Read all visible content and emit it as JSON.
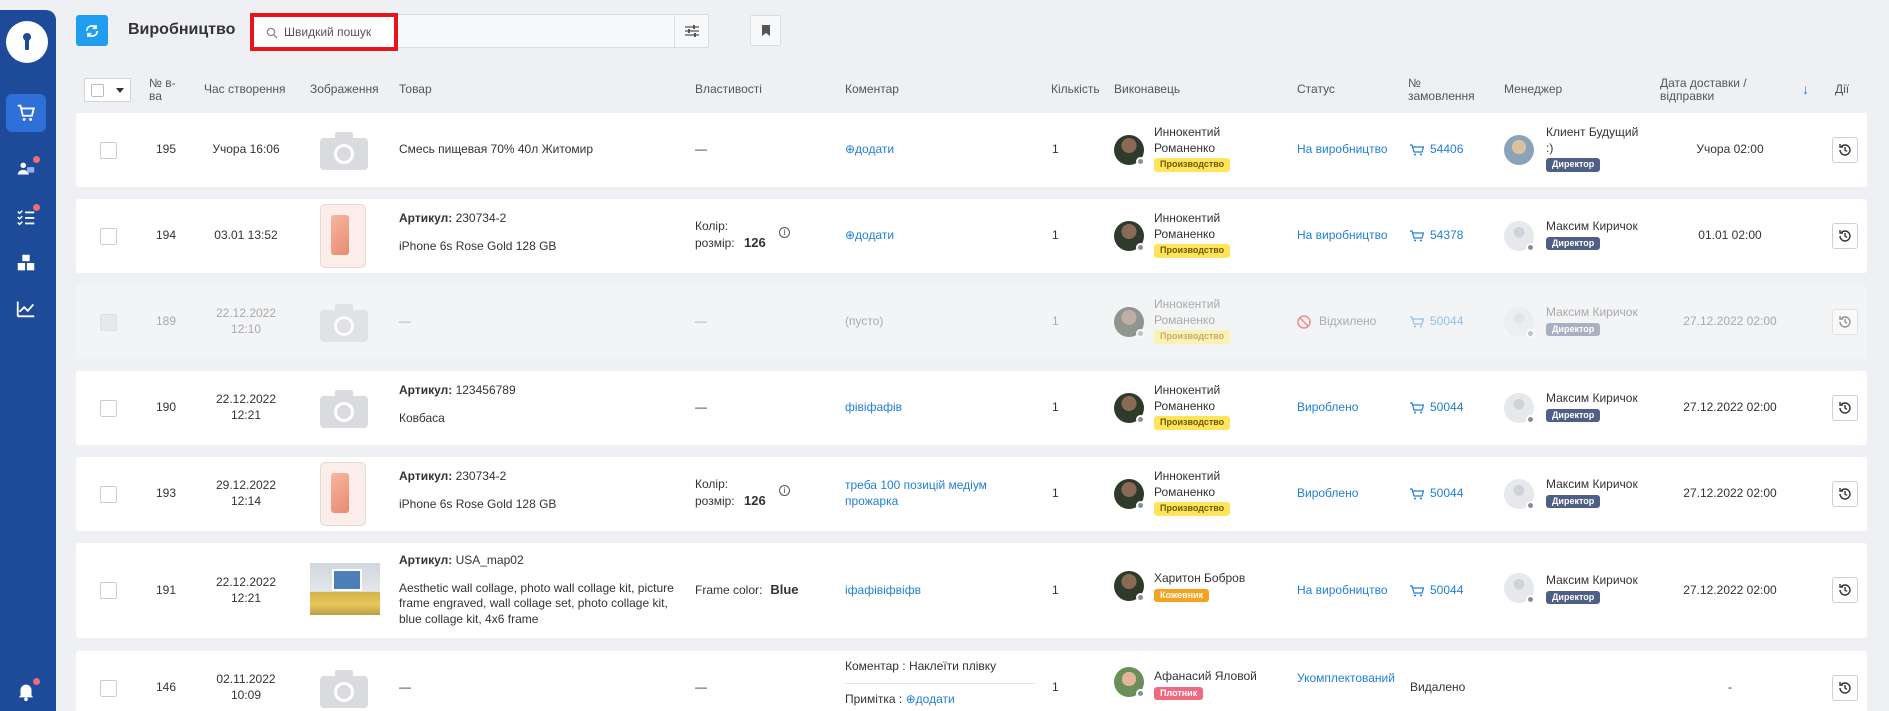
{
  "header": {
    "title": "Виробництво",
    "search_placeholder": "Швидкий пошук"
  },
  "columns": {
    "num": "№ в-ва",
    "created": "Час створення",
    "image": "Зображення",
    "product": "Товар",
    "props": "Властивості",
    "comment": "Коментар",
    "qty": "Кількість",
    "executor": "Виконавець",
    "status": "Статус",
    "order": "№ замовлення",
    "manager": "Менеджер",
    "delivery": "Дата доставки / відправки",
    "actions": "Дії"
  },
  "rows": [
    {
      "id": "195",
      "created": "Учора 16:06",
      "image": "placeholder",
      "product_title": "",
      "product_sku": "",
      "product_name": "Смесь пищевая 70% 40л Житомир",
      "props": "—",
      "comment": "⊕додати",
      "qty": "1",
      "executor_name": "Иннокентий Романенко",
      "executor_role": "Производство",
      "status": "На виробництво",
      "order": "54406",
      "manager_name": "Клиент Будущий :)",
      "manager_role": "Директор",
      "delivery": "Учора 02:00"
    },
    {
      "id": "194",
      "created": "03.01 13:52",
      "image": "phone",
      "product_title": "Артикул:",
      "product_sku": "230734-2",
      "product_name": "iPhone 6s Rose Gold 128 GB",
      "props_label1": "Колір:",
      "props_label2": "розмір:",
      "props_value": "126",
      "comment": "⊕додати",
      "qty": "1",
      "executor_name": "Иннокентий Романенко",
      "executor_role": "Производство",
      "status": "На виробництво",
      "order": "54378",
      "manager_name": "Максим Киричок",
      "manager_role": "Директор",
      "delivery": "01.01 02:00"
    },
    {
      "id": "189",
      "created": "22.12.2022 12:10",
      "image": "placeholder",
      "product_name": "—",
      "props": "—",
      "comment": "(пусто)",
      "qty": "1",
      "executor_name": "Иннокентий Романенко",
      "executor_role": "Производство",
      "status": "Відхилено",
      "order": "50044",
      "manager_name": "Максим Киричок",
      "manager_role": "Директор",
      "delivery": "27.12.2022 02:00"
    },
    {
      "id": "190",
      "created": "22.12.2022 12:21",
      "image": "placeholder",
      "product_title": "Артикул:",
      "product_sku": "123456789",
      "product_name": "Ковбаса",
      "props": "—",
      "comment": "фівіфафів",
      "qty": "1",
      "executor_name": "Иннокентий Романенко",
      "executor_role": "Производство",
      "status": "Вироблено",
      "order": "50044",
      "manager_name": "Максим Киричок",
      "manager_role": "Директор",
      "delivery": "27.12.2022 02:00"
    },
    {
      "id": "193",
      "created": "29.12.2022 12:14",
      "image": "phone",
      "product_title": "Артикул:",
      "product_sku": "230734-2",
      "product_name": "iPhone 6s Rose Gold 128 GB",
      "props_label1": "Колір:",
      "props_label2": "розмір:",
      "props_value": "126",
      "comment": "треба 100 позицій медіум прожарка",
      "qty": "1",
      "executor_name": "Иннокентий Романенко",
      "executor_role": "Производство",
      "status": "Вироблено",
      "order": "50044",
      "manager_name": "Максим Киричок",
      "manager_role": "Директор",
      "delivery": "27.12.2022 02:00"
    },
    {
      "id": "191",
      "created": "22.12.2022 12:21",
      "image": "collage",
      "product_title": "Артикул:",
      "product_sku": "USA_map02",
      "product_name": "Aesthetic wall collage, photo wall collage kit, picture frame engraved, wall collage set, photo collage kit, blue collage kit, 4x6 frame",
      "props_label1": "Frame color:",
      "props_value": "Blue",
      "comment": "іфафівіфвіфв",
      "qty": "1",
      "executor_name": "Харитон Бобров",
      "executor_role": "Кожевник",
      "status": "На виробництво",
      "order": "50044",
      "manager_name": "Максим Киричок",
      "manager_role": "Директор",
      "delivery": "27.12.2022 02:00"
    },
    {
      "id": "146",
      "created": "02.11.2022 10:09",
      "image": "placeholder",
      "product_name": "—",
      "props": "—",
      "comment_label": "Коментар :",
      "comment_text": "Наклеїти плівку",
      "note_label": "Примітка :",
      "note_action": "⊕додати",
      "qty": "1",
      "executor_name": "Афанасий Яловой",
      "executor_role": "Плотник",
      "status": "Укомплектований",
      "order_text": "Видалено",
      "delivery": "-"
    }
  ]
}
